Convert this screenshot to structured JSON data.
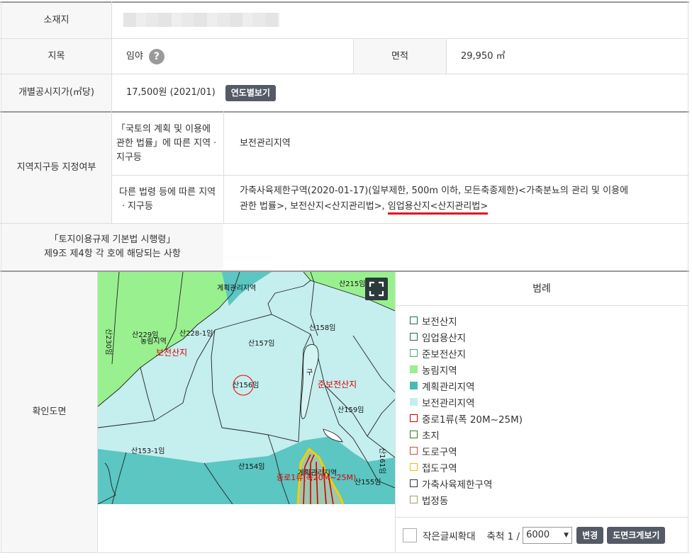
{
  "info": {
    "location_label": "소재지",
    "jimok_label": "지목",
    "jimok_value": "임야",
    "help_symbol": "?",
    "area_label": "면적",
    "area_value": "29,950 ㎡",
    "price_label": "개별공시지가(㎡당)",
    "price_value": "17,500원 (2021/01)",
    "yearly_button": "연도별보기"
  },
  "zoning": {
    "section_label": "지역지구등 지정여부",
    "national_law_label": "「국토의 계획 및 이용에 관한 법률」에 따른 지역ㆍ지구등",
    "national_law_value": "보전관리지역",
    "other_law_label": "다른 법령 등에 따른 지역ㆍ지구등",
    "other_law_value_1": "가축사육제한구역(2020-01-17)(일부제한, 500m 이하, 모든축종제한)<가축분뇨의 관리 및 이용에",
    "other_law_value_2_prefix": "관한 법률>, 보전산지<산지관리법>, ",
    "other_law_value_2_highlight": "임업용산지<산지관리법>",
    "regulation_label_1": "「토지이용규제 기본법 시행령」",
    "regulation_label_2": "제9조 제4항 각 호에 해당되는 사항",
    "regulation_value": ""
  },
  "map": {
    "section_label": "확인도면",
    "labels": {
      "top_zone": "계획관리지역",
      "san215": "산215임",
      "san229": "산229임",
      "nongrim": "농림지역",
      "san228": "산228-1임",
      "san230": "산230임",
      "bojeon": "보전산지",
      "san157": "산157임",
      "san158": "산158임",
      "san156": "산156임",
      "junbojeon": "준보전산지",
      "san159": "산159임",
      "san153": "산153-1임",
      "san154": "산154임",
      "san161": "산161임",
      "road_label": "중로1류(폭20M~25M)",
      "planned2": "계획관리지역",
      "san155": "산155임",
      "gu": "구"
    },
    "colors": {
      "nongrim": "#99f08f",
      "bojeon_manage": "#c5eeee",
      "planned_manage": "#5bc6c2",
      "road_red": "#cc0000",
      "jeobdo_yellow": "#f0d000"
    }
  },
  "legend": {
    "title": "범례",
    "items": [
      {
        "label": "보전산지",
        "color": "#1c6e4c",
        "fill": "none"
      },
      {
        "label": "임업용산지",
        "color": "#1c6e4c",
        "fill": "none"
      },
      {
        "label": "준보전산지",
        "color": "#4aa58a",
        "fill": "none"
      },
      {
        "label": "농림지역",
        "color": "#99f08f",
        "fill": "#99f08f"
      },
      {
        "label": "계획관리지역",
        "color": "#4ab8b4",
        "fill": "#4ab8b4"
      },
      {
        "label": "보전관리지역",
        "color": "#c5eeee",
        "fill": "#c5eeee"
      },
      {
        "label": "중로1류(폭 20M~25M)",
        "color": "#cc0000",
        "fill": "none"
      },
      {
        "label": "초지",
        "color": "#3a7a2a",
        "fill": "none"
      },
      {
        "label": "도로구역",
        "color": "#c84a4a",
        "fill": "none"
      },
      {
        "label": "접도구역",
        "color": "#e6c400",
        "fill": "none"
      },
      {
        "label": "가축사육제한구역",
        "color": "#333333",
        "fill": "none"
      },
      {
        "label": "법정동",
        "color": "#a89a70",
        "fill": "none"
      }
    ]
  },
  "controls": {
    "small_text_label": "작은글씨확대",
    "scale_label": "축척 1 /",
    "scale_value": "6000",
    "change_button": "변경",
    "enlarge_button": "도면크게보기"
  }
}
